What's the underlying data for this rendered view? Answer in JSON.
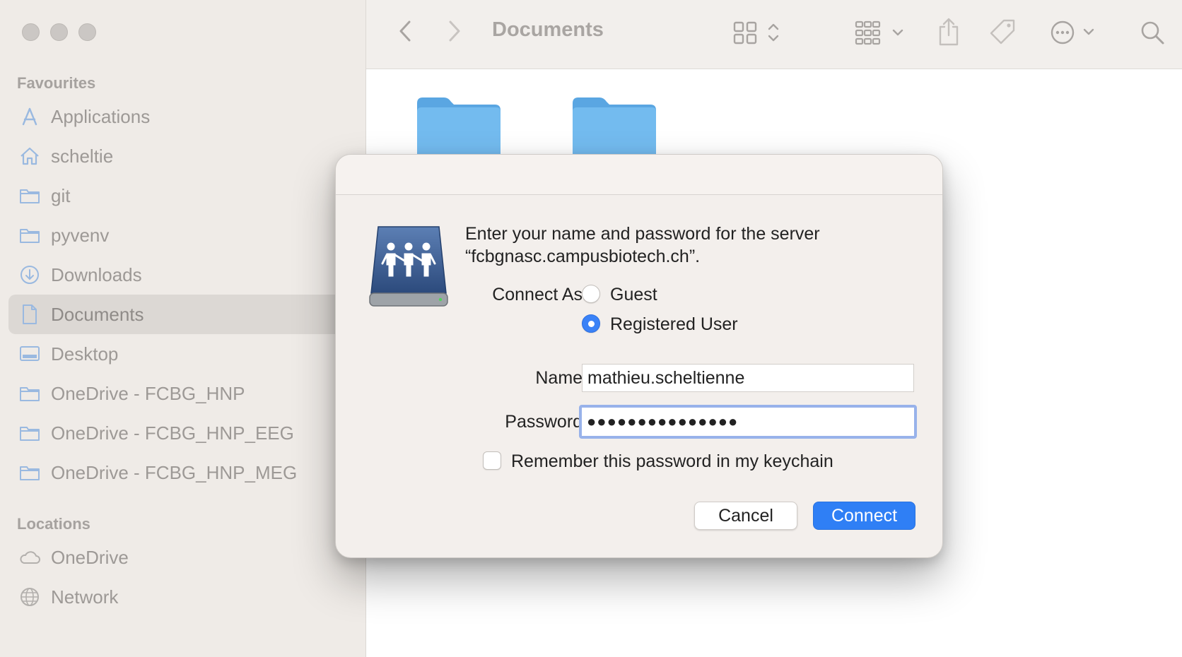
{
  "window": {
    "title": "Documents"
  },
  "sidebar": {
    "favourites_title": "Favourites",
    "favourites": [
      {
        "label": "Applications",
        "icon": "applications-icon",
        "selected": false
      },
      {
        "label": "scheltie",
        "icon": "home-icon",
        "selected": false
      },
      {
        "label": "git",
        "icon": "folder-icon",
        "selected": false
      },
      {
        "label": "pyvenv",
        "icon": "folder-icon",
        "selected": false
      },
      {
        "label": "Downloads",
        "icon": "download-icon",
        "selected": false
      },
      {
        "label": "Documents",
        "icon": "document-icon",
        "selected": true
      },
      {
        "label": "Desktop",
        "icon": "desktop-icon",
        "selected": false
      },
      {
        "label": "OneDrive - FCBG_HNP",
        "icon": "folder-icon",
        "selected": false
      },
      {
        "label": "OneDrive - FCBG_HNP_EEG",
        "icon": "folder-icon",
        "selected": false
      },
      {
        "label": "OneDrive - FCBG_HNP_MEG",
        "icon": "folder-icon",
        "selected": false
      }
    ],
    "locations_title": "Locations",
    "locations": [
      {
        "label": "OneDrive",
        "icon": "cloud-icon"
      },
      {
        "label": "Network",
        "icon": "globe-icon"
      }
    ]
  },
  "toolbar": {
    "icons": [
      "back-icon",
      "forward-icon",
      "grid-view-icon",
      "group-icon",
      "share-icon",
      "tag-icon",
      "more-icon",
      "search-icon"
    ]
  },
  "dialog": {
    "prompt_line1": "Enter your name and password for the server",
    "prompt_line2": "“fcbgnasc.campusbiotech.ch”.",
    "connect_as_label": "Connect As:",
    "option_guest": "Guest",
    "option_registered": "Registered User",
    "selected_option": "Registered User",
    "name_label": "Name:",
    "name_value": "mathieu.scheltienne",
    "password_label": "Password:",
    "password_value": "●●●●●●●●●●●●●●●",
    "remember_label": "Remember this password in my keychain",
    "remember_checked": false,
    "cancel_label": "Cancel",
    "connect_label": "Connect"
  },
  "colors": {
    "accent": "#2f7ff5",
    "sidebar_bg": "#efebe7",
    "folder_blue": "#6cb4ec"
  }
}
